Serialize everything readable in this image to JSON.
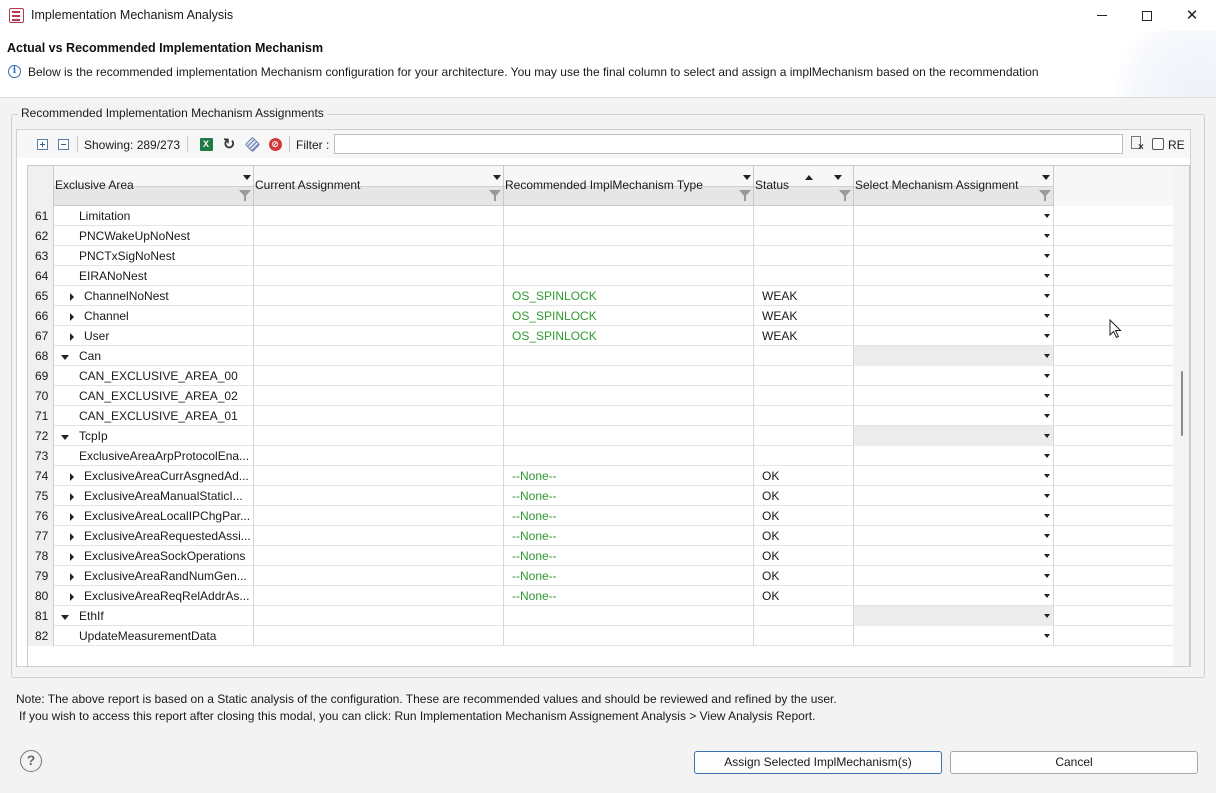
{
  "window": {
    "title": "Implementation Mechanism Analysis"
  },
  "header": {
    "title": "Actual vs Recommended Implementation Mechanism",
    "description": "Below is the recommended implementation Mechanism configuration for your architecture. You may use the final column to select and assign a implMechanism based on the recommendation"
  },
  "group": {
    "label": "Recommended Implementation Mechanism Assignments"
  },
  "toolbar": {
    "showing": "Showing: 289/273",
    "filter_label": "Filter :",
    "filter_value": "",
    "re_label": "RE",
    "excel_glyph": "X"
  },
  "table": {
    "columns": [
      {
        "label": "Exclusive Area"
      },
      {
        "label": "Current Assignment"
      },
      {
        "label": "Recommended ImplMechanism Type"
      },
      {
        "label": "Status"
      },
      {
        "label": "Select Mechanism Assignment"
      }
    ],
    "rows": [
      {
        "num": "61",
        "area": "Limitation",
        "tree": "",
        "rec": "",
        "status": "",
        "disabled": false
      },
      {
        "num": "62",
        "area": "PNCWakeUpNoNest",
        "tree": "",
        "rec": "",
        "status": "",
        "disabled": false
      },
      {
        "num": "63",
        "area": "PNCTxSigNoNest",
        "tree": "",
        "rec": "",
        "status": "",
        "disabled": false
      },
      {
        "num": "64",
        "area": "EIRANoNest",
        "tree": "",
        "rec": "",
        "status": "",
        "disabled": false
      },
      {
        "num": "65",
        "area": "ChannelNoNest",
        "tree": "collapsed",
        "rec": "OS_SPINLOCK",
        "status": "WEAK",
        "disabled": false
      },
      {
        "num": "66",
        "area": "Channel",
        "tree": "collapsed",
        "rec": "OS_SPINLOCK",
        "status": "WEAK",
        "disabled": false
      },
      {
        "num": "67",
        "area": "User",
        "tree": "collapsed",
        "rec": "OS_SPINLOCK",
        "status": "WEAK",
        "disabled": false
      },
      {
        "num": "68",
        "area": "Can",
        "tree": "expanded",
        "rec": "",
        "status": "",
        "disabled": true
      },
      {
        "num": "69",
        "area": "CAN_EXCLUSIVE_AREA_00",
        "tree": "",
        "rec": "",
        "status": "",
        "disabled": false
      },
      {
        "num": "70",
        "area": "CAN_EXCLUSIVE_AREA_02",
        "tree": "",
        "rec": "",
        "status": "",
        "disabled": false
      },
      {
        "num": "71",
        "area": "CAN_EXCLUSIVE_AREA_01",
        "tree": "",
        "rec": "",
        "status": "",
        "disabled": false
      },
      {
        "num": "72",
        "area": "TcpIp",
        "tree": "expanded",
        "rec": "",
        "status": "",
        "disabled": true
      },
      {
        "num": "73",
        "area": "ExclusiveAreaArpProtocolEna...",
        "tree": "",
        "rec": "",
        "status": "",
        "disabled": false
      },
      {
        "num": "74",
        "area": "ExclusiveAreaCurrAsgnedAd...",
        "tree": "collapsed",
        "rec": "--None--",
        "status": "OK",
        "disabled": false
      },
      {
        "num": "75",
        "area": "ExclusiveAreaManualStaticI...",
        "tree": "collapsed",
        "rec": "--None--",
        "status": "OK",
        "disabled": false
      },
      {
        "num": "76",
        "area": "ExclusiveAreaLocalIPChgPar...",
        "tree": "collapsed",
        "rec": "--None--",
        "status": "OK",
        "disabled": false
      },
      {
        "num": "77",
        "area": "ExclusiveAreaRequestedAssi...",
        "tree": "collapsed",
        "rec": "--None--",
        "status": "OK",
        "disabled": false
      },
      {
        "num": "78",
        "area": "ExclusiveAreaSockOperations",
        "tree": "collapsed",
        "rec": "--None--",
        "status": "OK",
        "disabled": false
      },
      {
        "num": "79",
        "area": "ExclusiveAreaRandNumGen...",
        "tree": "collapsed",
        "rec": "--None--",
        "status": "OK",
        "disabled": false
      },
      {
        "num": "80",
        "area": "ExclusiveAreaReqRelAddrAs...",
        "tree": "collapsed",
        "rec": "--None--",
        "status": "OK",
        "disabled": false
      },
      {
        "num": "81",
        "area": "EthIf",
        "tree": "expanded",
        "rec": "",
        "status": "",
        "disabled": true
      },
      {
        "num": "82",
        "area": "UpdateMeasurementData",
        "tree": "",
        "rec": "",
        "status": "",
        "disabled": false
      }
    ]
  },
  "footer": {
    "note_line1": "Note: The above report is based on a Static analysis of the configuration. These are recommended values and should be reviewed and refined by the user.",
    "note_line2": "If you wish to access this report after closing this modal, you can click: Run Implementation Mechanism Assignement Analysis > View Analysis Report.",
    "help_glyph": "?",
    "assign_label": "Assign Selected ImplMechanism(s)",
    "cancel_label": "Cancel"
  },
  "colors": {
    "recommended_text": "#2f9a2f",
    "accent_border": "#3c6fb4"
  }
}
